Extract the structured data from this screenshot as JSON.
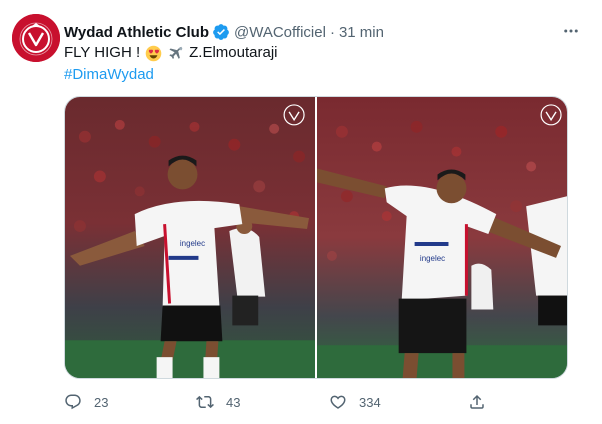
{
  "tweet": {
    "author_name": "Wydad Athletic Club",
    "handle": "@WACofficiel",
    "separator": "·",
    "time": "31 min",
    "text_prefix": "FLY HIGH !",
    "player": "Z.Elmoutaraji",
    "hashtag": "#DimaWydad"
  },
  "media": {
    "photo_count": 2,
    "jersey_text": "ingelec"
  },
  "actions": {
    "reply_count": "23",
    "retweet_count": "43",
    "like_count": "334"
  },
  "icons": {
    "verified": "verified-badge-icon",
    "more": "more-icon",
    "emoji1": "heart-eyes-emoji-icon",
    "emoji2": "airplane-emoji-icon",
    "reply": "reply-icon",
    "retweet": "retweet-icon",
    "like": "like-icon",
    "share": "share-icon"
  },
  "colors": {
    "accent": "#1d9bf0",
    "muted": "#536471",
    "brand_red": "#c8102e"
  }
}
